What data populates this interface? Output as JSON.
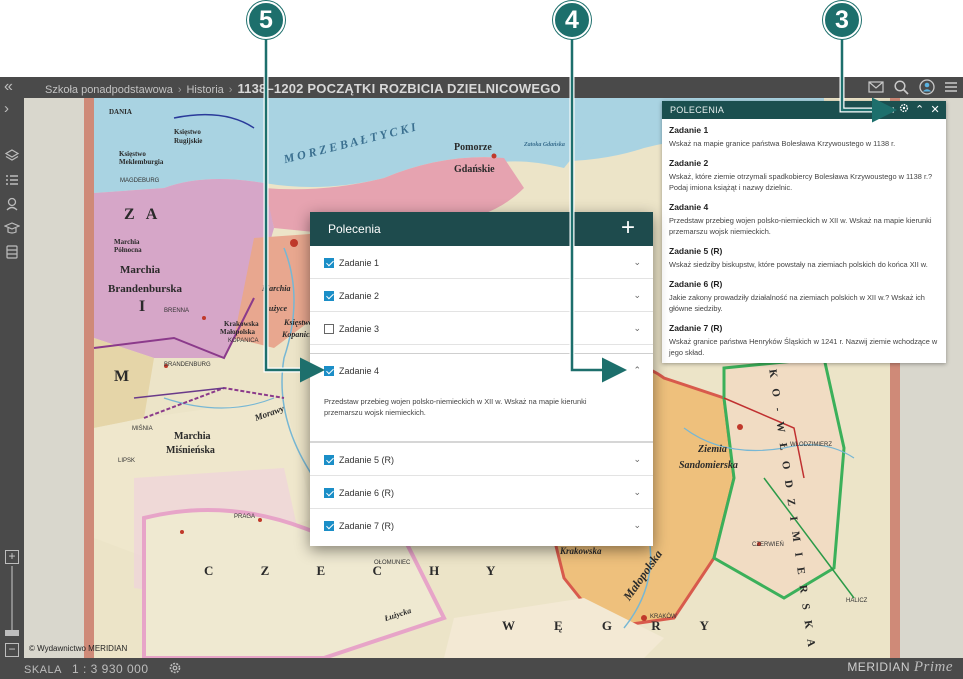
{
  "topbar": {
    "crumbs": [
      "Szkoła ponadpodstawowa",
      "Historia"
    ],
    "separator": "›",
    "title": "1138–1202 POCZĄTKI ROZBICIA DZIELNICOWEGO"
  },
  "map": {
    "copyright": "© Wydawnictwo MERIDIAN",
    "labels_large": [
      "M O R Z E   B A Ł T Y C K I",
      "Pomorze",
      "Gdańskie",
      "Z A",
      "M",
      "I",
      "Marchia",
      "Brandenburska",
      "Marchia",
      "Miśnieńska",
      "C Z E C H Y",
      "W Ę G R Y",
      "Ziemia",
      "Sandomierska",
      "Krakowska",
      "Małopolska",
      "K O - W Ł O D Z I M I E R S K A",
      "Zatoka Gdańska",
      "Ziemia",
      "Lubuska",
      "Księstwo",
      "Kopanickie",
      "Łużyce",
      "Marchia",
      "Łużycka",
      "Marchia",
      "Północna",
      "DANIA",
      "Księstwo",
      "Rugijskie",
      "Księstwo",
      "Meklemburgia",
      "Morawy",
      "Milska",
      "Ziemia"
    ],
    "labels_small": [
      "MAGDEBURG",
      "LIPSK",
      "PRAGA",
      "OŁOMUNIEC",
      "WŁODZIMIERZ",
      "CZERWIEŃ",
      "HALICZ",
      "BRANDENBURG",
      "BRENNA",
      "KOPANICA",
      "ROSTOCK",
      "SZCZECIN",
      "KOŁOBRZEG",
      "GDAŃSK",
      "SANDOMIERZ",
      "KRAKÓW",
      "LUBUSZ",
      "BUDZISZYN",
      "MIŚNIA"
    ]
  },
  "scale": {
    "label": "SKALA",
    "value": "1 : 3 930 000"
  },
  "brand": {
    "name": "MERIDIAN",
    "suffix": "Prime"
  },
  "panel": {
    "title": "POLECENIA",
    "tasks": [
      {
        "name": "Zadanie 1",
        "text": "Wskaż na mapie granice państwa Bolesława Krzywoustego w 1138 r."
      },
      {
        "name": "Zadanie 2",
        "text": "Wskaż, które ziemie otrzymali spadkobiercy Bolesława Krzywoustego w 1138 r.? Podaj imiona książąt i nazwy dzielnic."
      },
      {
        "name": "Zadanie 4",
        "text": "Przedstaw przebieg wojen polsko-niemieckich w XII w. Wskaż na mapie kierunki przemarszu wojsk niemieckich."
      },
      {
        "name": "Zadanie 5 (R)",
        "text": "Wskaż siedziby biskupstw, które powstały na ziemiach polskich do końca XII w."
      },
      {
        "name": "Zadanie 6 (R)",
        "text": "Jakie zakony prowadziły działalność na ziemiach polskich w XII w.? Wskaż ich główne siedziby."
      },
      {
        "name": "Zadanie 7 (R)",
        "text": "Wskaż granice państwa Henryków Śląskich w 1241 r. Nazwij ziemie wchodzące w jego skład."
      }
    ]
  },
  "modal": {
    "title": "Polecenia",
    "add_label": "+",
    "items": [
      {
        "label": "Zadanie 1",
        "checked": true
      },
      {
        "label": "Zadanie 2",
        "checked": true
      },
      {
        "label": "Zadanie 3",
        "checked": false
      },
      {
        "label": "Zadanie 4",
        "checked": true,
        "expanded": true,
        "text": "Przedstaw przebieg wojen polsko-niemieckich w XII w. Wskaż na mapie kierunki przemarszu wojsk niemieckich."
      },
      {
        "label": "Zadanie 5 (R)",
        "checked": true
      },
      {
        "label": "Zadanie 6 (R)",
        "checked": true
      },
      {
        "label": "Zadanie 7 (R)",
        "checked": true
      }
    ]
  },
  "callouts": [
    "5",
    "4",
    "3"
  ],
  "colors": {
    "accent": "#1d6f6c",
    "header": "#1e4b4d",
    "checkbox": "#1b8ec7",
    "chrome": "#4a4a4a"
  }
}
